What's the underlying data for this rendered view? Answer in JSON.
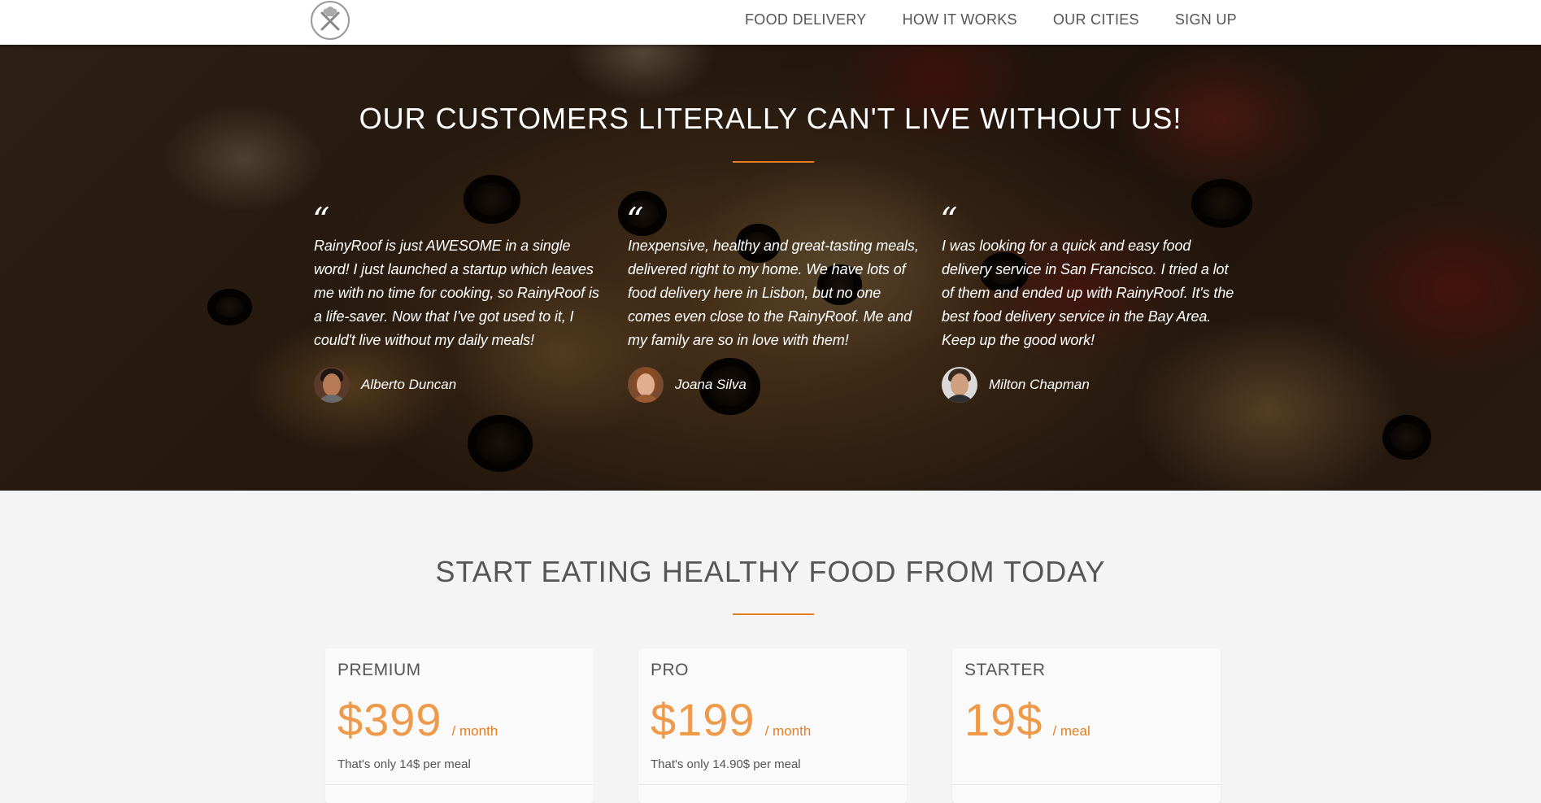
{
  "nav": {
    "logo_icon": "chef-logo-icon",
    "links": [
      "FOOD DELIVERY",
      "HOW IT WORKS",
      "OUR CITIES",
      "SIGN UP"
    ]
  },
  "testimonials": {
    "title": "OUR CUSTOMERS LITERALLY CAN'T LIVE WITHOUT US!",
    "quote_mark": "“",
    "items": [
      {
        "quote": "RainyRoof is just AWESOME in a single word! I just launched a startup which leaves me with no time for cooking, so RainyRoof is a life-saver. Now that I've got used to it, I could't live without my daily meals!",
        "author": "Alberto Duncan"
      },
      {
        "quote": "Inexpensive, healthy and great-tasting meals, delivered right to my home. We have lots of food delivery here in Lisbon, but no one comes even close to the RainyRoof. Me and my family are so in love with them!",
        "author": "Joana Silva"
      },
      {
        "quote": "I was looking for a quick and easy food delivery service in San Francisco. I tried a lot of them and ended up with RainyRoof. It's the best food delivery service in the Bay Area. Keep up the good work!",
        "author": "Milton Chapman"
      }
    ]
  },
  "pricing": {
    "title": "START EATING HEALTHY FOOD FROM TODAY",
    "plans": [
      {
        "name": "PREMIUM",
        "price": "$399",
        "period": "/ month",
        "note": "That's only 14$ per meal"
      },
      {
        "name": "PRO",
        "price": "$199",
        "period": "/ month",
        "note": "That's only 14.90$ per meal"
      },
      {
        "name": "STARTER",
        "price": "19$",
        "period": "/ meal",
        "note": ""
      }
    ]
  },
  "colors": {
    "accent": "#e67e22",
    "text_dark": "#555555",
    "nav_bg": "#ffffff",
    "section_bg": "#f4f4f4"
  }
}
